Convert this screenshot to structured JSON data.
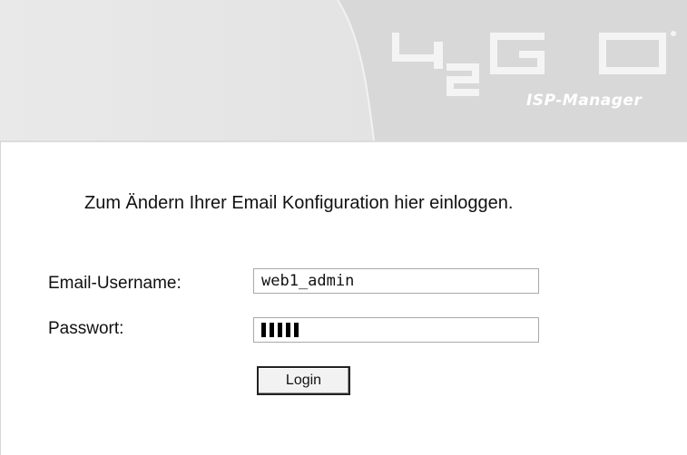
{
  "header": {
    "logo_subtitle": "ISP-Manager"
  },
  "form": {
    "intro": "Zum Ändern Ihrer Email Konfiguration hier einloggen.",
    "username_label": "Email-Username:",
    "username_value": "web1_admin",
    "password_label": "Passwort:",
    "password_mask_count": 5,
    "login_label": "Login"
  }
}
